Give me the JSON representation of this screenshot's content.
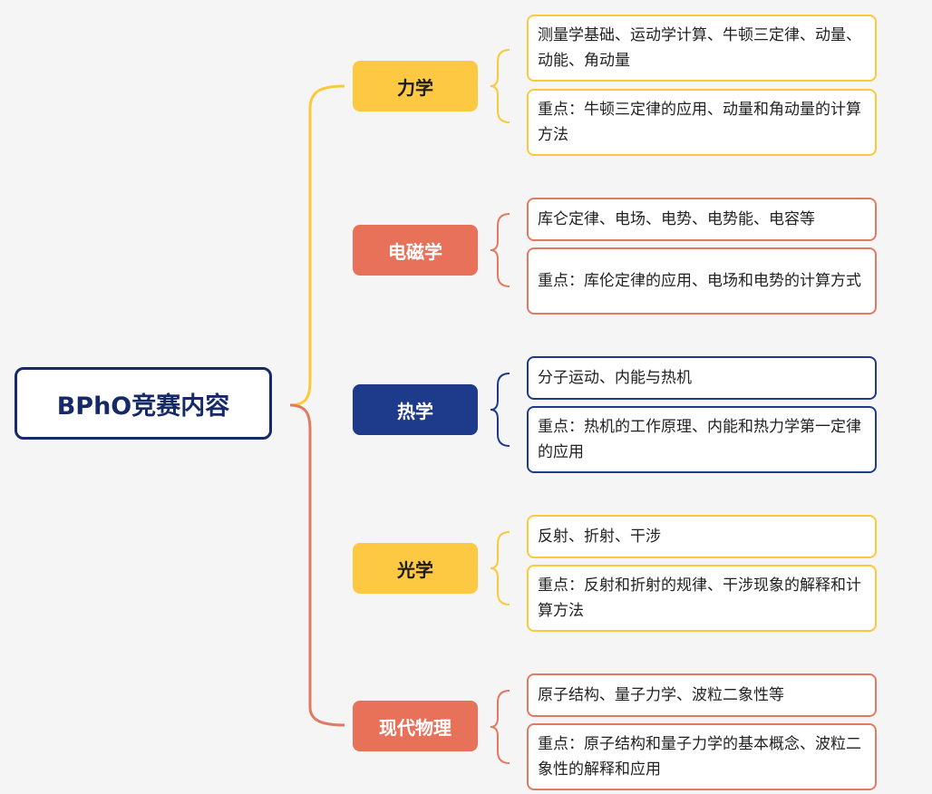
{
  "root": {
    "label": "BPhO竞赛内容"
  },
  "branches": [
    {
      "label": "力学",
      "color": "#fdc842",
      "notes": [
        "测量学基础、运动学计算、牛顿三定律、动量、动能、角动量",
        "重点：牛顿三定律的应用、动量和角动量的计算方法"
      ]
    },
    {
      "label": "电磁学",
      "color": "#e8715a",
      "notes": [
        "库仑定律、电场、电势、电势能、电容等",
        "重点：库伦定律的应用、电场和电势的计算方式"
      ]
    },
    {
      "label": "热学",
      "color": "#1e3a8a",
      "notes": [
        "分子运动、内能与热机",
        "重点：热机的工作原理、内能和热力学第一定律的应用"
      ]
    },
    {
      "label": "光学",
      "color": "#fdc842",
      "notes": [
        "反射、折射、干涉",
        "重点：反射和折射的规律、干涉现象的解释和计算方法"
      ]
    },
    {
      "label": "现代物理",
      "color": "#e8715a",
      "notes": [
        "原子结构、量子力学、波粒二象性等",
        "重点：原子结构和量子力学的基本概念、波粒二象性的解释和应用"
      ]
    }
  ]
}
